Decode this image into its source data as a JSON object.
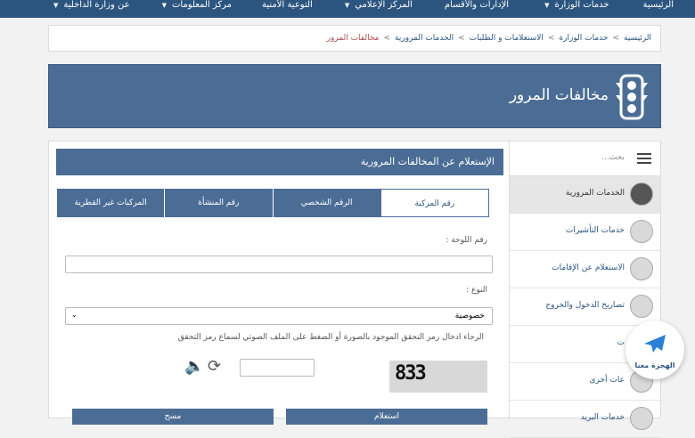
{
  "topnav": {
    "items": [
      "الرئيسية",
      "خدمات الوزارة",
      "الإدارات والأقسام",
      "المركز الإعلامي",
      "التوعية الأمنية",
      "مركز المعلومات",
      "عن وزارة الداخلية"
    ]
  },
  "breadcrumb": [
    "الرئيسية",
    "خدمات الوزارة",
    "الاستعلامات و الطلبات",
    "الخدمات المرورية",
    "مخالفات المرور"
  ],
  "banner": {
    "title": "مخالفات المرور"
  },
  "sidebar": {
    "search_placeholder": "بحث...",
    "items": [
      "الخدمات المرورية",
      "خدمات التأشيرات",
      "الاستعلام عن الإقامات",
      "تصاريح الدخول والخروج",
      "ت",
      "عات أخرى",
      "خدمات البريد"
    ]
  },
  "form": {
    "title": "الإستعلام عن المخالفات المرورية",
    "tabs": [
      "رقم المركبة",
      "الرقم الشخصي",
      "رقم المنشأة",
      "المركبات غير القطرية"
    ],
    "plate_label": "رقم اللوحة :",
    "type_label": "النوع :",
    "type_value": "خصوصية",
    "captcha_hint": "الرجاء ادخال رمز التحقق الموجود بالصورة أو الضغط على الملف الصوتي لسماع رمز التحقق",
    "captcha_text": "833",
    "submit": "استعلام",
    "clear": "مسح"
  },
  "fab": {
    "label": "الهجرة معنا"
  },
  "colors": {
    "primary": "#4b6d95",
    "nav": "#2b557f"
  }
}
